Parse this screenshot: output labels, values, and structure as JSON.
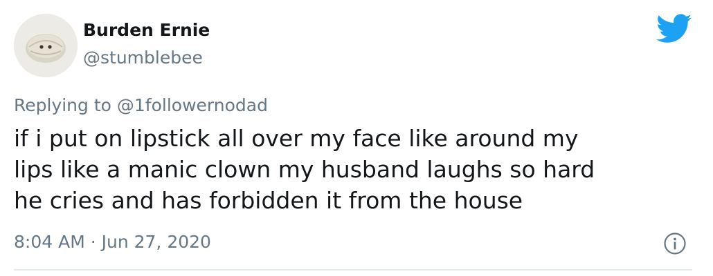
{
  "author": {
    "display_name": "Burden Ernie",
    "handle": "@stumblebee"
  },
  "reply": {
    "prefix": "Replying to",
    "target": "@1followernodad"
  },
  "tweet": {
    "lines": [
      "if i put on lipstick all over my face like around my",
      "lips like a manic clown my husband laughs so hard",
      "he cries and has forbidden it from the house"
    ],
    "timestamp": "8:04 AM · Jun 27, 2020"
  },
  "icons": {
    "brand": "twitter-bird-icon",
    "info": "info-icon"
  },
  "colors": {
    "brand": "#1da1f2",
    "text": "#14171a",
    "secondary": "#657786",
    "divider": "#e1e8ed"
  }
}
